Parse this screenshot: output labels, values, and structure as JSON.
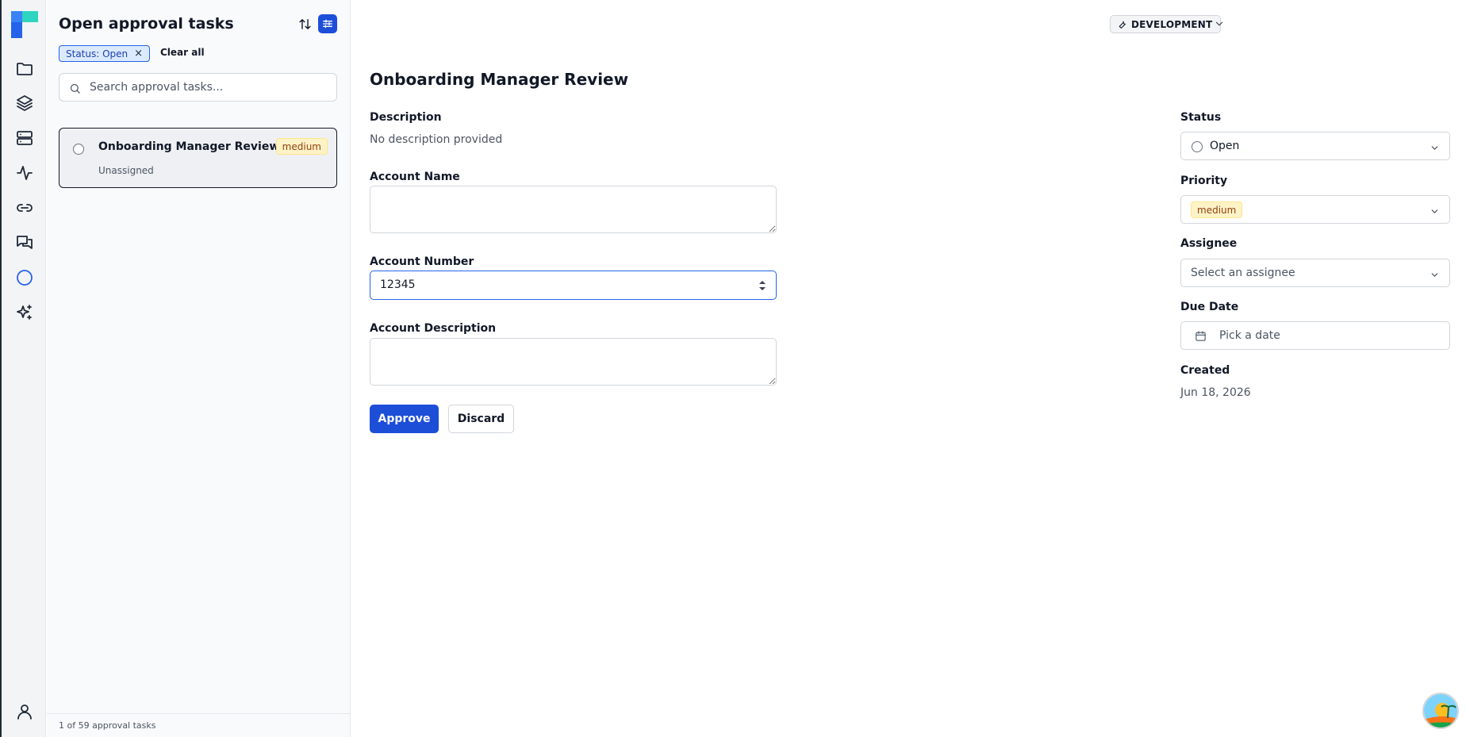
{
  "rail": {
    "items": [
      "folder-icon",
      "layers-icon",
      "server-icon",
      "activity-icon",
      "link-icon",
      "messages-icon",
      "approval-circle-icon",
      "sparkles-icon"
    ],
    "bottom": "user-icon"
  },
  "list": {
    "title": "Open approval tasks",
    "filter_chip": "Status: Open",
    "chip_remove": "×",
    "clear_all": "Clear all",
    "search_placeholder": "Search approval tasks...",
    "tasks": [
      {
        "name": "Onboarding Manager Review",
        "assignee": "Unassigned",
        "priority": "medium"
      }
    ],
    "footer": "1 of 59 approval tasks"
  },
  "environment": {
    "label": "DEVELOPMENT"
  },
  "task": {
    "title": "Onboarding Manager Review",
    "description_label": "Description",
    "description_value": "No description provided",
    "account_name_label": "Account Name",
    "account_name_value": "",
    "account_number_label": "Account Number",
    "account_number_value": "12345",
    "account_description_label": "Account Description",
    "account_description_value": "",
    "approve_label": "Approve",
    "discard_label": "Discard"
  },
  "meta": {
    "status_label": "Status",
    "status_value": "Open",
    "priority_label": "Priority",
    "priority_value": "medium",
    "assignee_label": "Assignee",
    "assignee_placeholder": "Select an assignee",
    "due_date_label": "Due Date",
    "due_date_placeholder": "Pick a date",
    "created_label": "Created",
    "created_value": "Jun 18, 2026"
  },
  "colors": {
    "accent": "#1d4ed8",
    "priority_medium_bg": "#fef3c7",
    "chip_bg": "#dbeafe"
  }
}
